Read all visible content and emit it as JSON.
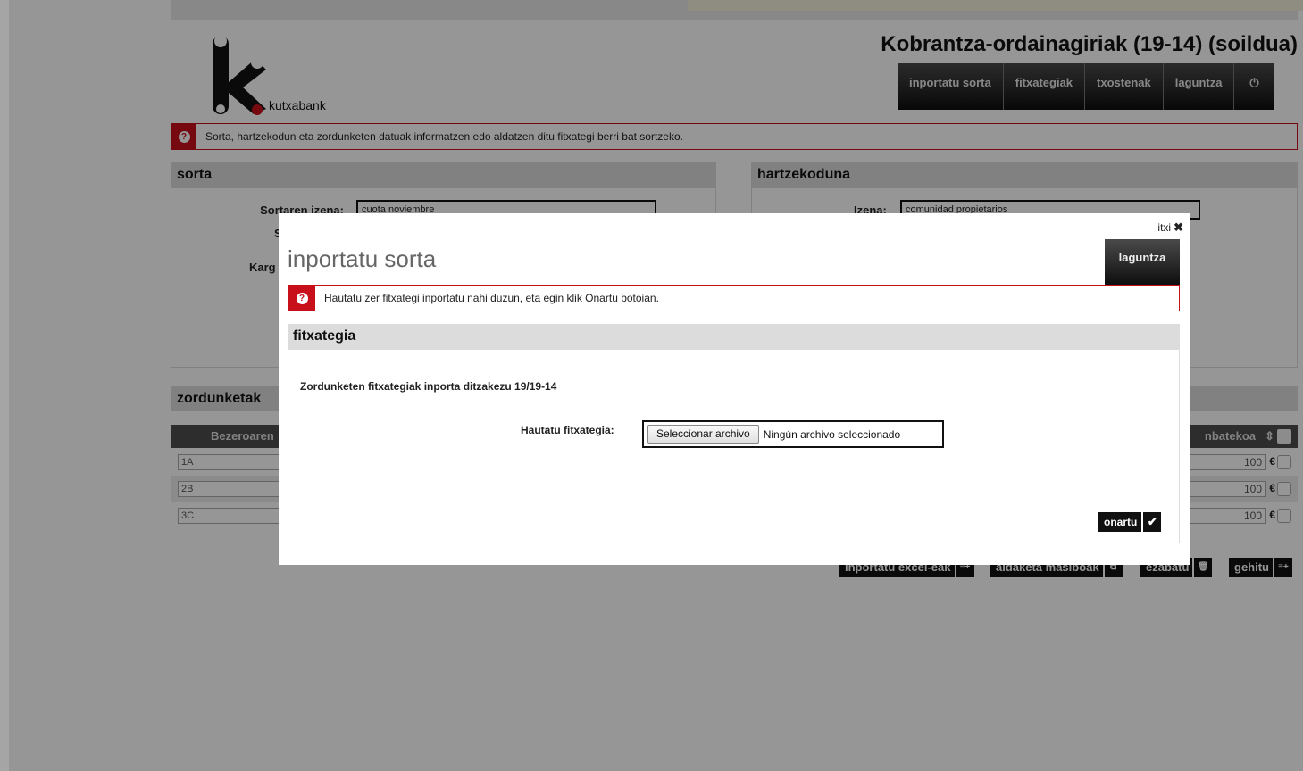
{
  "app": {
    "logo_text": "kutxabank",
    "title": "Kobrantza-ordainagiriak (19-14) (soildua)"
  },
  "topnav": {
    "items": [
      "inportatu sorta",
      "fitxategiak",
      "txostenak",
      "laguntza"
    ],
    "power_icon": "⏻"
  },
  "info_message": "Sorta, hartzekodun eta zordunketen datuak informatzen edo aldatzen ditu fitxategi berri bat sortzeko.",
  "sorta": {
    "title": "sorta",
    "name_label": "Sortaren izena:",
    "name_value": "cuota noviembre",
    "second_label_partial": "S",
    "third_label_partial": "Karg"
  },
  "hartzekoduna": {
    "title": "hartzekoduna",
    "name_label": "Izena:",
    "name_value": "comunidad propietarios"
  },
  "zordunketak": {
    "title": "zordunketak",
    "col_left_partial": "Bezeroaren",
    "col_right_partial": "nbatekoa",
    "sort_icon": "⇕",
    "rows": [
      {
        "client": "1A",
        "amount": "100",
        "currency": "€"
      },
      {
        "client": "2B",
        "amount": "100",
        "currency": "€"
      },
      {
        "client": "3C",
        "amount": "100",
        "currency": "€"
      }
    ]
  },
  "bottom_buttons": [
    {
      "label": "inportatu excel-eak",
      "icon": "≡+"
    },
    {
      "label": "aldaketa masiboak",
      "icon": "⧉"
    },
    {
      "label": "ezabatu",
      "icon": "🗑"
    },
    {
      "label": "gehitu",
      "icon": "≡+"
    }
  ],
  "modal": {
    "close_label": "itxi",
    "close_icon": "✖",
    "title": "inportatu sorta",
    "help_label": "laguntza",
    "info_message": "Hautatu zer fitxategi inportatu nahi duzun, eta egin klik Onartu botoian.",
    "section_title": "fitxategia",
    "intro": "Zordunketen fitxategiak inporta ditzakezu 19/19-14",
    "file_label": "Hautatu fitxategia:",
    "file_button": "Seleccionar archivo",
    "file_status": "Ningún archivo seleccionado",
    "submit_label": "onartu",
    "submit_icon": "✔"
  },
  "colors": {
    "accent_red": "#c8101b",
    "dark_button": "#111111",
    "panel_header": "#dcdcdc"
  }
}
